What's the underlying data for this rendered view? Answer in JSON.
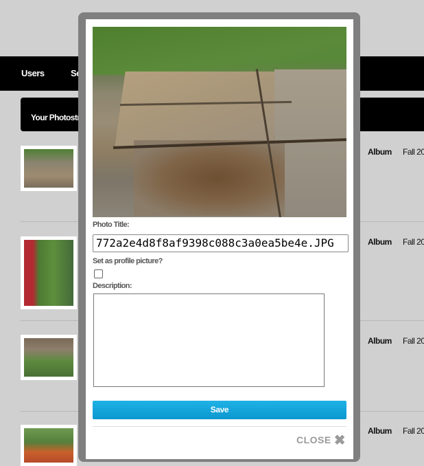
{
  "nav": {
    "items": [
      "Users",
      "Setti"
    ]
  },
  "stream": {
    "header": "Your Photostream",
    "rows": [
      {
        "label": "Album",
        "date": "Fall 20"
      },
      {
        "label": "Album",
        "date": "Fall 20"
      },
      {
        "label": "Album",
        "date": "Fall 20"
      },
      {
        "label": "Album",
        "date": "Fall 20"
      }
    ]
  },
  "modal": {
    "photo_title_label": "Photo Title:",
    "photo_title_value": "772a2e4d8f8af9398c088c3a0ea5be4e.JPG",
    "profile_label": "Set as profile picture?",
    "description_label": "Description:",
    "description_value": "",
    "save_label": "Save",
    "close_label": "CLOSE",
    "close_icon": "✖"
  },
  "colors": {
    "accent": "#0ea3d9",
    "nav_bg": "#000000",
    "overlay_frame": "#7f7f7f"
  }
}
